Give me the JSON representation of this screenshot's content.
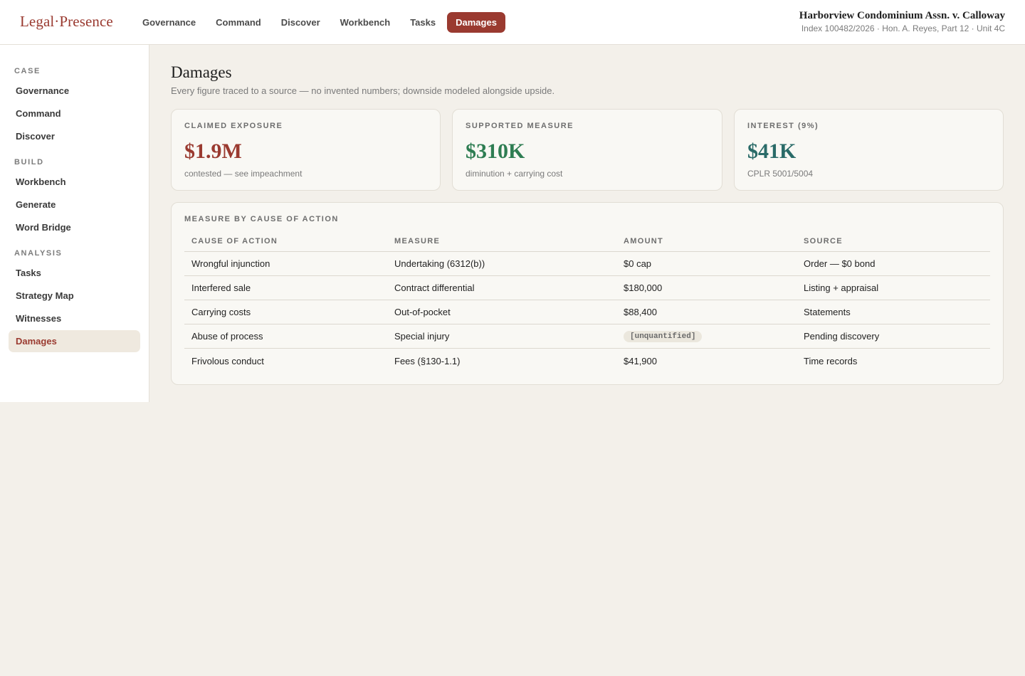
{
  "app": {
    "brand": "Legal·Presence"
  },
  "topnav": [
    {
      "label": "Governance",
      "active": false
    },
    {
      "label": "Command",
      "active": false
    },
    {
      "label": "Discover",
      "active": false
    },
    {
      "label": "Workbench",
      "active": false
    },
    {
      "label": "Tasks",
      "active": false
    },
    {
      "label": "Damages",
      "active": true
    }
  ],
  "case": {
    "title": "Harborview Condominium Assn. v. Calloway",
    "subtitle": "Index 100482/2026 · Hon. A. Reyes, Part 12 · Unit 4C"
  },
  "sidebar": {
    "sections": [
      {
        "title": "CASE",
        "items": [
          "Governance",
          "Command",
          "Discover"
        ]
      },
      {
        "title": "BUILD",
        "items": [
          "Workbench",
          "Generate",
          "Word Bridge"
        ]
      },
      {
        "title": "ANALYSIS",
        "items": [
          "Tasks",
          "Strategy Map",
          "Witnesses",
          "Damages"
        ]
      }
    ],
    "active_item": "Damages"
  },
  "main": {
    "title": "Damages",
    "subtitle": "Every figure traced to a source — no invented numbers; downside modeled alongside upside."
  },
  "metrics": [
    {
      "label": "CLAIMED EXPOSURE",
      "value": "$1.9M",
      "note": "contested — see impeachment",
      "color": "#9a3a30"
    },
    {
      "label": "SUPPORTED MEASURE",
      "value": "$310K",
      "note": "diminution + carrying cost",
      "color": "#2e7d52"
    },
    {
      "label": "INTEREST (9%)",
      "value": "$41K",
      "note": "CPLR 5001/5004",
      "color": "#2a6b68"
    }
  ],
  "measure_table": {
    "title": "MEASURE BY CAUSE OF ACTION",
    "columns": [
      "CAUSE OF ACTION",
      "MEASURE",
      "AMOUNT",
      "SOURCE"
    ],
    "rows": [
      {
        "cause": "Wrongful injunction",
        "measure": "Undertaking (6312(b))",
        "amount": "$0 cap",
        "amount_is_badge": false,
        "source": "Order — $0 bond"
      },
      {
        "cause": "Interfered sale",
        "measure": "Contract differential",
        "amount": "$180,000",
        "amount_is_badge": false,
        "source": "Listing + appraisal"
      },
      {
        "cause": "Carrying costs",
        "measure": "Out-of-pocket",
        "amount": "$88,400",
        "amount_is_badge": false,
        "source": "Statements"
      },
      {
        "cause": "Abuse of process",
        "measure": "Special injury",
        "amount": "[unquantified]",
        "amount_is_badge": true,
        "source": "Pending discovery"
      },
      {
        "cause": "Frivolous conduct",
        "measure": "Fees (§130-1.1)",
        "amount": "$41,900",
        "amount_is_badge": false,
        "source": "Time records"
      }
    ]
  }
}
